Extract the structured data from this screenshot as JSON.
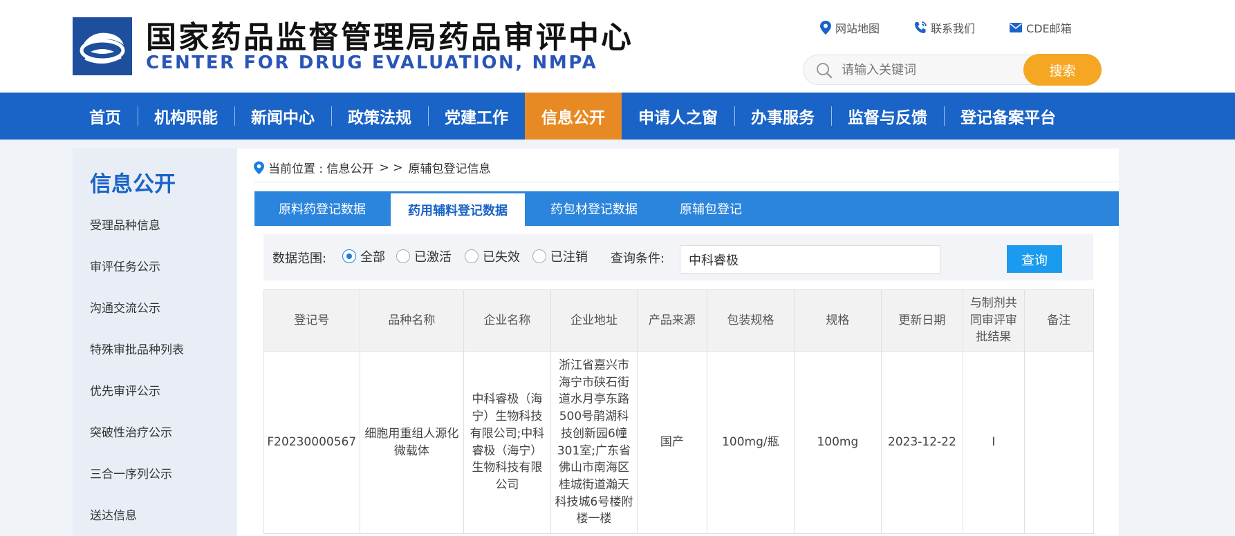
{
  "header": {
    "title_cn": "国家药品监督管理局药品审评中心",
    "title_en": "CENTER FOR DRUG EVALUATION, NMPA",
    "links": [
      {
        "label": "网站地图",
        "icon": "location-pin-icon"
      },
      {
        "label": "联系我们",
        "icon": "phone-icon"
      },
      {
        "label": "CDE邮箱",
        "icon": "mail-icon"
      }
    ],
    "search": {
      "placeholder": "请输入关键词",
      "value": "",
      "button": "搜索"
    }
  },
  "nav": {
    "items": [
      {
        "label": "首页",
        "active": false
      },
      {
        "label": "机构职能",
        "active": false
      },
      {
        "label": "新闻中心",
        "active": false
      },
      {
        "label": "政策法规",
        "active": false
      },
      {
        "label": "党建工作",
        "active": false
      },
      {
        "label": "信息公开",
        "active": true
      },
      {
        "label": "申请人之窗",
        "active": false
      },
      {
        "label": "办事服务",
        "active": false
      },
      {
        "label": "监督与反馈",
        "active": false
      },
      {
        "label": "登记备案平台",
        "active": false
      }
    ]
  },
  "sidebar": {
    "title": "信息公开",
    "items": [
      {
        "label": "受理品种信息"
      },
      {
        "label": "审评任务公示"
      },
      {
        "label": "沟通交流公示"
      },
      {
        "label": "特殊审批品种列表"
      },
      {
        "label": "优先审评公示"
      },
      {
        "label": "突破性治疗公示"
      },
      {
        "label": "三合一序列公示"
      },
      {
        "label": "送达信息"
      }
    ]
  },
  "breadcrumb": {
    "prefix": "当前位置 : 信息公开",
    "sep": "> >",
    "current": "原辅包登记信息"
  },
  "tabs": [
    {
      "label": "原料药登记数据",
      "active": false
    },
    {
      "label": "药用辅料登记数据",
      "active": true
    },
    {
      "label": "药包材登记数据",
      "active": false
    },
    {
      "label": "原辅包登记",
      "active": false
    }
  ],
  "filter": {
    "range_label": "数据范围:",
    "options": [
      {
        "label": "全部",
        "checked": true
      },
      {
        "label": "已激活",
        "checked": false
      },
      {
        "label": "已失效",
        "checked": false
      },
      {
        "label": "已注销",
        "checked": false
      }
    ],
    "condition_label": "查询条件:",
    "condition_value": "中科睿极",
    "query_button": "查询"
  },
  "table": {
    "columns": [
      "登记号",
      "品种名称",
      "企业名称",
      "企业地址",
      "产品来源",
      "包装规格",
      "规格",
      "更新日期",
      "与制剂共同审评审批结果",
      "备注"
    ],
    "rows": [
      [
        "F20230000567",
        "细胞用重组人源化微载体",
        "中科睿极（海宁）生物科技有限公司;中科睿极（海宁）生物科技有限公司",
        "浙江省嘉兴市海宁市硖石街道水月亭东路500号鹃湖科技创新园6幢301室;广东省佛山市南海区桂城街道瀚天科技城6号楼附楼一楼",
        "国产",
        "100mg/瓶",
        "100mg",
        "2023-12-22",
        "I",
        ""
      ]
    ]
  },
  "colors": {
    "nav_bg": "#1a63c7",
    "nav_active": "#e88a24",
    "tab_bar": "#2c85dc",
    "search_button": "#f5a623",
    "query_button": "#1a9bf0",
    "title_en": "#2a54b8"
  }
}
